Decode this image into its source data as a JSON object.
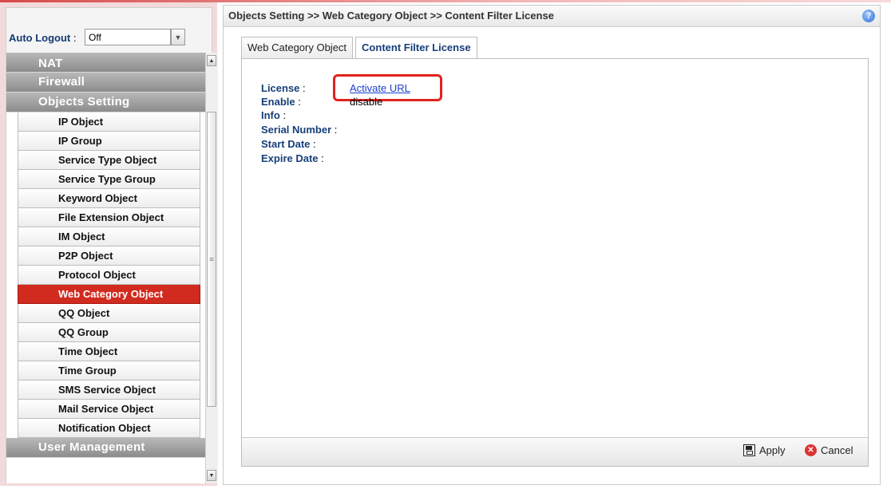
{
  "breadcrumb": "Objects Setting >> Web Category Object >> Content Filter License",
  "help_icon": "?",
  "auto_logout": {
    "label": "Auto Logout",
    "colon": " :",
    "value": "Off"
  },
  "menu": {
    "top_category": "NAT",
    "firewall": "Firewall",
    "objects_setting": "Objects Setting",
    "items": [
      "IP Object",
      "IP Group",
      "Service Type Object",
      "Service Type Group",
      "Keyword Object",
      "File Extension Object",
      "IM Object",
      "P2P Object",
      "Protocol Object",
      "Web Category Object",
      "QQ Object",
      "QQ Group",
      "Time Object",
      "Time Group",
      "SMS Service Object",
      "Mail Service Object",
      "Notification Object"
    ],
    "active_item": "Web Category Object",
    "bottom_category": "User Management"
  },
  "tabs": [
    "Web Category Object",
    "Content Filter License"
  ],
  "license": {
    "license_label": "License",
    "license_value": "Activate URL",
    "enable_label": "Enable",
    "enable_value": "disable",
    "info_label": "Info",
    "serial_label": "Serial Number",
    "start_label": "Start Date",
    "expire_label": "Expire Date",
    "colon": " :"
  },
  "buttons": {
    "apply": "Apply",
    "cancel": "Cancel"
  },
  "colors": {
    "accent": "#d12b1f",
    "heading_blue": "#173f79",
    "link": "#1a3fcf"
  }
}
